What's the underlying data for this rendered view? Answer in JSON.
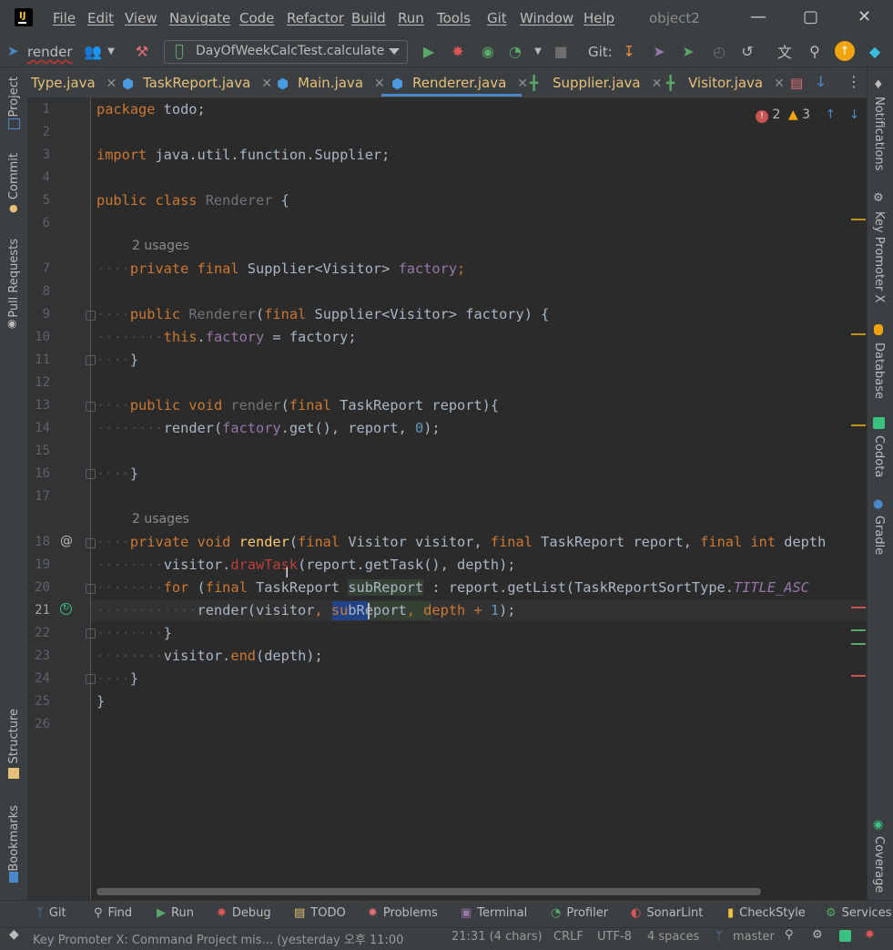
{
  "window": {
    "project_title": "object2",
    "menu": [
      "File",
      "Edit",
      "View",
      "Navigate",
      "Code",
      "Refactor",
      "Build",
      "Run",
      "Tools",
      "Git",
      "Window",
      "Help"
    ]
  },
  "toolbar": {
    "branch_label": "render",
    "run_config": "DayOfWeekCalcTest.calculate",
    "git_label": "Git:"
  },
  "tabs": [
    {
      "label": "Type.java",
      "active": false
    },
    {
      "label": "TaskReport.java",
      "active": false
    },
    {
      "label": "Main.java",
      "active": false
    },
    {
      "label": "Renderer.java",
      "active": true
    },
    {
      "label": "Supplier.java",
      "active": false
    },
    {
      "label": "Visitor.java",
      "active": false
    }
  ],
  "left_tools": [
    "Project",
    "Commit",
    "Pull Requests",
    "Structure",
    "Bookmarks"
  ],
  "right_tools": [
    "Notifications",
    "Key Promoter X",
    "Database",
    "Codota",
    "Gradle",
    "Coverage"
  ],
  "inspections": {
    "errors": "2",
    "warnings": "3"
  },
  "editor": {
    "line_numbers": [
      "1",
      "2",
      "3",
      "4",
      "5",
      "6",
      "7",
      "8",
      "9",
      "10",
      "11",
      "12",
      "13",
      "14",
      "15",
      "16",
      "17",
      "18",
      "19",
      "20",
      "21",
      "22",
      "23",
      "24",
      "25",
      "26"
    ],
    "usages_1": "2 usages",
    "usages_2": "2 usages",
    "lines": {
      "l1_kw": "package",
      "l1_rest": " todo;",
      "l3_kw": "import",
      "l3_rest": " java.util.function.Supplier;",
      "l5_kw": "public class",
      "l5_name": " Renderer",
      "l5_rest": " {",
      "l7_kw": "private final",
      "l7_type": " Supplier<Visitor>",
      "l7_field": " factory",
      "l7_end": ";",
      "l9_kw": "public",
      "l9_name": " Renderer",
      "l9_p1": "(",
      "l9_kw2": "final",
      "l9_rest": " Supplier<Visitor> factory) {",
      "l10_kw": "this",
      "l10_dot": ".",
      "l10_field": "factory",
      "l10_rest": " = factory;",
      "l11": "}",
      "l13_kw": "public void",
      "l13_name": " render",
      "l13_p": "(",
      "l13_kw2": "final",
      "l13_rest": " TaskReport report){",
      "l14_a": "render(",
      "l14_field": "factory",
      "l14_b": ".get(), report, ",
      "l14_num": "0",
      "l14_c": ");",
      "l16": "}",
      "l18_kw": "private void",
      "l18_name": " render",
      "l18_p": "(",
      "l18_kw2": "final",
      "l18_t1": " Visitor visitor, ",
      "l18_kw3": "final",
      "l18_t2": " TaskReport report, ",
      "l18_kw4": "final int",
      "l18_t3": " depth",
      "l19_a": "visitor.",
      "l19_m": "drawTask",
      "l19_b": "(report.getTask(), depth);",
      "l20_kw": "for",
      "l20_a": " (",
      "l20_kw2": "final",
      "l20_b": " TaskReport ",
      "l20_v": "subReport",
      "l20_c": " : report.getList(TaskReportSortType.",
      "l20_i": "TITLE_ASC",
      "l21_a": "render(visitor",
      "l21_sel": ", su",
      "l21_b": "bReport",
      "l21_c": ", depth + ",
      "l21_num": "1",
      "l21_d": ");",
      "l22": "}",
      "l23_a": "visitor.",
      "l23_m": "end",
      "l23_b": "(depth);",
      "l24": "}",
      "l25": "}"
    }
  },
  "bottom_tools": [
    "Git",
    "Find",
    "Run",
    "Debug",
    "TODO",
    "Problems",
    "Terminal",
    "Profiler",
    "SonarLint",
    "CheckStyle",
    "Services"
  ],
  "status": {
    "message": "Key Promoter X: Command Project mis... (yesterday 오후 11:00",
    "position": "21:31 (4 chars)",
    "line_sep": "CRLF",
    "encoding": "UTF-8",
    "indent": "4 spaces",
    "branch": "master"
  },
  "colors": {
    "accent": "#4a88c7",
    "keyword": "#cc7832",
    "field": "#9876aa",
    "number": "#6897bb",
    "method": "#ffc66d"
  }
}
